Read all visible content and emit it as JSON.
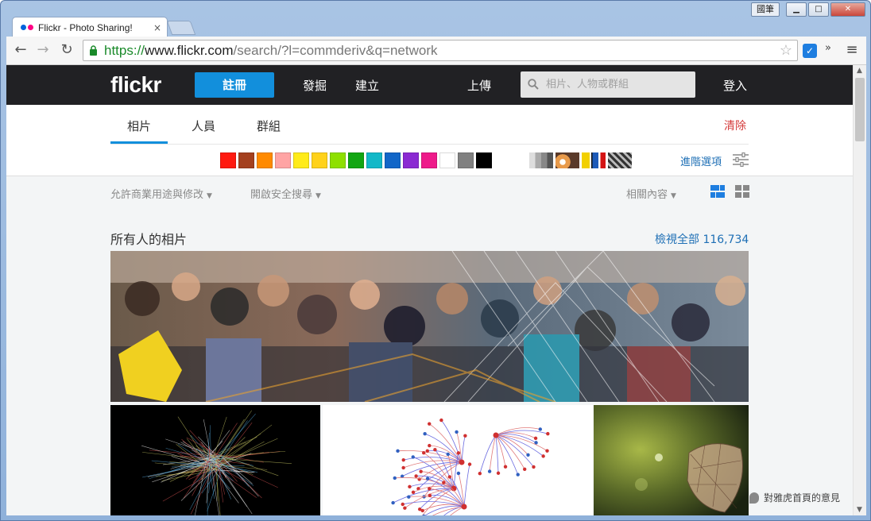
{
  "browser": {
    "tab_title": "Flickr - Photo Sharing!",
    "tab_close": "×",
    "ime_label": "國筆",
    "minimize": "▁",
    "maximize": "□",
    "close": "✕",
    "url_scheme": "https://",
    "url_host": "www.flickr.com",
    "url_path": "/search/?l=commderiv&q=network",
    "back_icon": "←",
    "forward_icon": "→",
    "reload_icon": "↻",
    "star_icon": "☆",
    "more_icon": "»",
    "menu_icon": "≡"
  },
  "header": {
    "logo": "flickr",
    "signup": "註冊",
    "nav": [
      "發掘",
      "建立",
      "上傳"
    ],
    "search_placeholder": "相片、人物或群組",
    "login": "登入"
  },
  "filters": {
    "tabs": [
      "相片",
      "人員",
      "群組"
    ],
    "active_tab": "相片",
    "clear": "清除",
    "colors": [
      "#ff1a10",
      "#a4401e",
      "#ff8a00",
      "#ffa4a4",
      "#ffeb1a",
      "#ffd21a",
      "#8ee000",
      "#12a612",
      "#12b8c8",
      "#1266c8",
      "#8a2ad2",
      "#ee1a8a",
      "#ffffff",
      "#808080",
      "#000000"
    ],
    "advanced": "進階選項"
  },
  "subbar": {
    "license": "允許商業用途與修改",
    "safesearch": "開啟安全搜尋",
    "sort": "相關內容"
  },
  "results": {
    "section_title": "所有人的相片",
    "view_all": "檢視全部 116,734"
  },
  "feedback": "對雅虎首頁的意見"
}
